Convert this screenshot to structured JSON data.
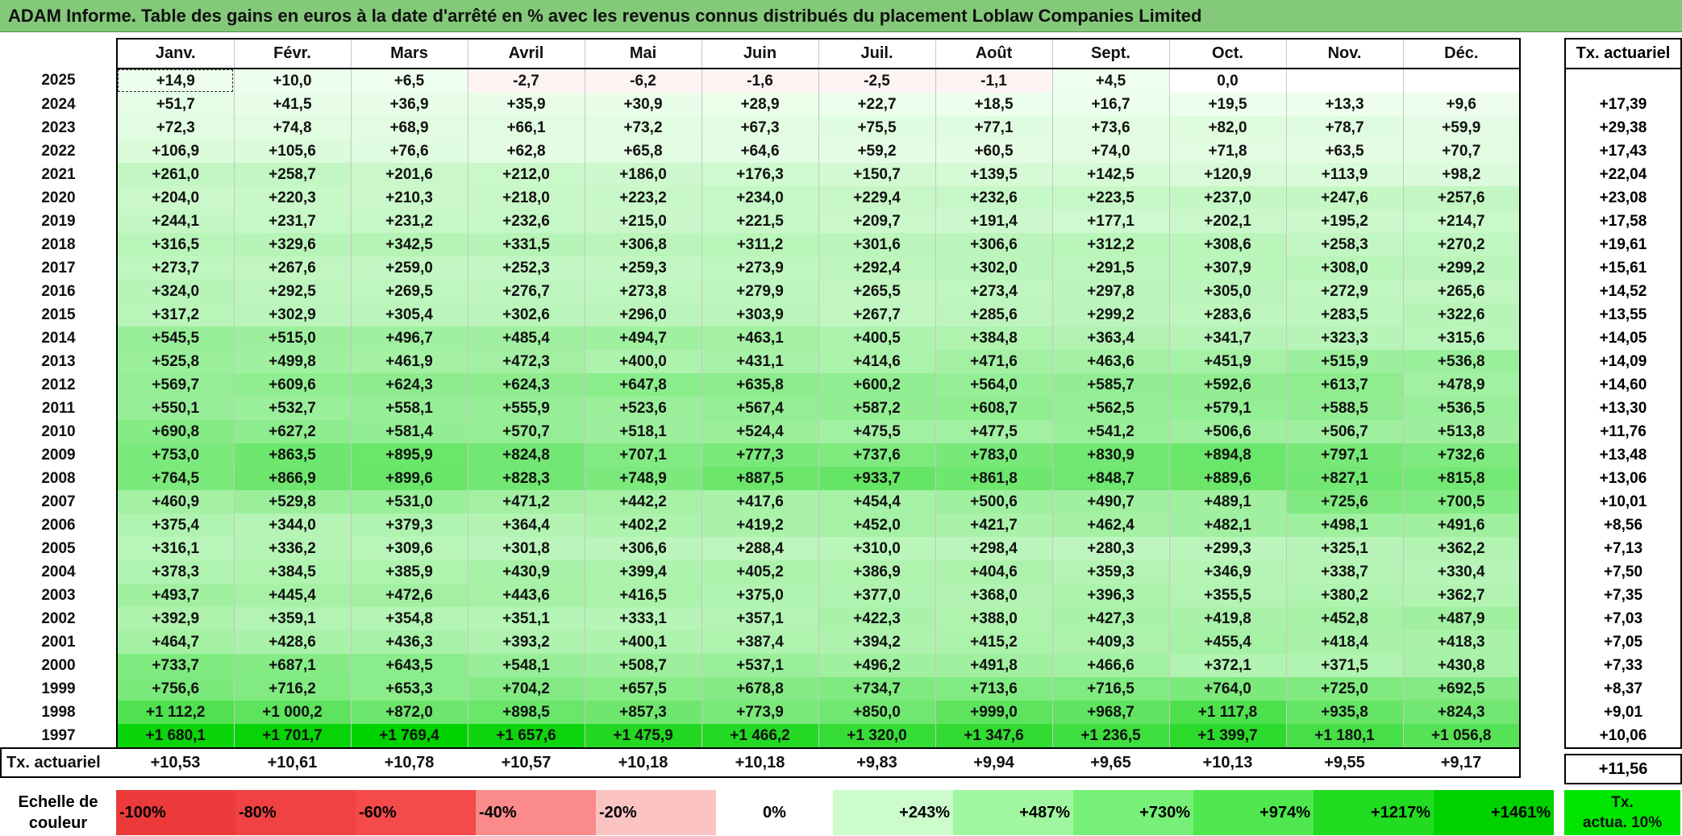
{
  "title": "ADAM Informe. Table des gains en euros à la date d'arrêté en % avec les revenus connus distribués du placement Loblaw Companies Limited",
  "months": [
    "Janv.",
    "Févr.",
    "Mars",
    "Avril",
    "Mai",
    "Juin",
    "Juil.",
    "Août",
    "Sept.",
    "Oct.",
    "Nov.",
    "Déc."
  ],
  "side_header": "Tx. actuariel",
  "rows": [
    {
      "year": "2025",
      "values": [
        "+14,9",
        "+10,0",
        "+6,5",
        "-2,7",
        "-6,2",
        "-1,6",
        "-2,5",
        "-1,1",
        "+4,5",
        "0,0",
        "",
        ""
      ],
      "tx": ""
    },
    {
      "year": "2024",
      "values": [
        "+51,7",
        "+41,5",
        "+36,9",
        "+35,9",
        "+30,9",
        "+28,9",
        "+22,7",
        "+18,5",
        "+16,7",
        "+19,5",
        "+13,3",
        "+9,6"
      ],
      "tx": "+17,39"
    },
    {
      "year": "2023",
      "values": [
        "+72,3",
        "+74,8",
        "+68,9",
        "+66,1",
        "+73,2",
        "+67,3",
        "+75,5",
        "+77,1",
        "+73,6",
        "+82,0",
        "+78,7",
        "+59,9"
      ],
      "tx": "+29,38"
    },
    {
      "year": "2022",
      "values": [
        "+106,9",
        "+105,6",
        "+76,6",
        "+62,8",
        "+65,8",
        "+64,6",
        "+59,2",
        "+60,5",
        "+74,0",
        "+71,8",
        "+63,5",
        "+70,7"
      ],
      "tx": "+17,43"
    },
    {
      "year": "2021",
      "values": [
        "+261,0",
        "+258,7",
        "+201,6",
        "+212,0",
        "+186,0",
        "+176,3",
        "+150,7",
        "+139,5",
        "+142,5",
        "+120,9",
        "+113,9",
        "+98,2"
      ],
      "tx": "+22,04"
    },
    {
      "year": "2020",
      "values": [
        "+204,0",
        "+220,3",
        "+210,3",
        "+218,0",
        "+223,2",
        "+234,0",
        "+229,4",
        "+232,6",
        "+223,5",
        "+237,0",
        "+247,6",
        "+257,6"
      ],
      "tx": "+23,08"
    },
    {
      "year": "2019",
      "values": [
        "+244,1",
        "+231,7",
        "+231,2",
        "+232,6",
        "+215,0",
        "+221,5",
        "+209,7",
        "+191,4",
        "+177,1",
        "+202,1",
        "+195,2",
        "+214,7"
      ],
      "tx": "+17,58"
    },
    {
      "year": "2018",
      "values": [
        "+316,5",
        "+329,6",
        "+342,5",
        "+331,5",
        "+306,8",
        "+311,2",
        "+301,6",
        "+306,6",
        "+312,2",
        "+308,6",
        "+258,3",
        "+270,2"
      ],
      "tx": "+19,61"
    },
    {
      "year": "2017",
      "values": [
        "+273,7",
        "+267,6",
        "+259,0",
        "+252,3",
        "+259,3",
        "+273,9",
        "+292,4",
        "+302,0",
        "+291,5",
        "+307,9",
        "+308,0",
        "+299,2"
      ],
      "tx": "+15,61"
    },
    {
      "year": "2016",
      "values": [
        "+324,0",
        "+292,5",
        "+269,5",
        "+276,7",
        "+273,8",
        "+279,9",
        "+265,5",
        "+273,4",
        "+297,8",
        "+305,0",
        "+272,9",
        "+265,6"
      ],
      "tx": "+14,52"
    },
    {
      "year": "2015",
      "values": [
        "+317,2",
        "+302,9",
        "+305,4",
        "+302,6",
        "+296,0",
        "+303,9",
        "+267,7",
        "+285,6",
        "+299,2",
        "+283,6",
        "+283,5",
        "+322,6"
      ],
      "tx": "+13,55"
    },
    {
      "year": "2014",
      "values": [
        "+545,5",
        "+515,0",
        "+496,7",
        "+485,4",
        "+494,7",
        "+463,1",
        "+400,5",
        "+384,8",
        "+363,4",
        "+341,7",
        "+323,3",
        "+315,6"
      ],
      "tx": "+14,05"
    },
    {
      "year": "2013",
      "values": [
        "+525,8",
        "+499,8",
        "+461,9",
        "+472,3",
        "+400,0",
        "+431,1",
        "+414,6",
        "+471,6",
        "+463,6",
        "+451,9",
        "+515,9",
        "+536,8"
      ],
      "tx": "+14,09"
    },
    {
      "year": "2012",
      "values": [
        "+569,7",
        "+609,6",
        "+624,3",
        "+624,3",
        "+647,8",
        "+635,8",
        "+600,2",
        "+564,0",
        "+585,7",
        "+592,6",
        "+613,7",
        "+478,9"
      ],
      "tx": "+14,60"
    },
    {
      "year": "2011",
      "values": [
        "+550,1",
        "+532,7",
        "+558,1",
        "+555,9",
        "+523,6",
        "+567,4",
        "+587,2",
        "+608,7",
        "+562,5",
        "+579,1",
        "+588,5",
        "+536,5"
      ],
      "tx": "+13,30"
    },
    {
      "year": "2010",
      "values": [
        "+690,8",
        "+627,2",
        "+581,4",
        "+570,7",
        "+518,1",
        "+524,4",
        "+475,5",
        "+477,5",
        "+541,2",
        "+506,6",
        "+506,7",
        "+513,8"
      ],
      "tx": "+11,76"
    },
    {
      "year": "2009",
      "values": [
        "+753,0",
        "+863,5",
        "+895,9",
        "+824,8",
        "+707,1",
        "+777,3",
        "+737,6",
        "+783,0",
        "+830,9",
        "+894,8",
        "+797,1",
        "+732,6"
      ],
      "tx": "+13,48"
    },
    {
      "year": "2008",
      "values": [
        "+764,5",
        "+866,9",
        "+899,6",
        "+828,3",
        "+748,9",
        "+887,5",
        "+933,7",
        "+861,8",
        "+848,7",
        "+889,6",
        "+827,1",
        "+815,8"
      ],
      "tx": "+13,06"
    },
    {
      "year": "2007",
      "values": [
        "+460,9",
        "+529,8",
        "+531,0",
        "+471,2",
        "+442,2",
        "+417,6",
        "+454,4",
        "+500,6",
        "+490,7",
        "+489,1",
        "+725,6",
        "+700,5"
      ],
      "tx": "+10,01"
    },
    {
      "year": "2006",
      "values": [
        "+375,4",
        "+344,0",
        "+379,3",
        "+364,4",
        "+402,2",
        "+419,2",
        "+452,0",
        "+421,7",
        "+462,4",
        "+482,1",
        "+498,1",
        "+491,6"
      ],
      "tx": "+8,56"
    },
    {
      "year": "2005",
      "values": [
        "+316,1",
        "+336,2",
        "+309,6",
        "+301,8",
        "+306,6",
        "+288,4",
        "+310,0",
        "+298,4",
        "+280,3",
        "+299,3",
        "+325,1",
        "+362,2"
      ],
      "tx": "+7,13"
    },
    {
      "year": "2004",
      "values": [
        "+378,3",
        "+384,5",
        "+385,9",
        "+430,9",
        "+399,4",
        "+405,2",
        "+386,9",
        "+404,6",
        "+359,3",
        "+346,9",
        "+338,7",
        "+330,4"
      ],
      "tx": "+7,50"
    },
    {
      "year": "2003",
      "values": [
        "+493,7",
        "+445,4",
        "+472,6",
        "+443,6",
        "+416,5",
        "+375,0",
        "+377,0",
        "+368,0",
        "+396,3",
        "+355,5",
        "+380,2",
        "+362,7"
      ],
      "tx": "+7,35"
    },
    {
      "year": "2002",
      "values": [
        "+392,9",
        "+359,1",
        "+354,8",
        "+351,1",
        "+333,1",
        "+357,1",
        "+422,3",
        "+388,0",
        "+427,3",
        "+419,8",
        "+452,8",
        "+487,9"
      ],
      "tx": "+7,03"
    },
    {
      "year": "2001",
      "values": [
        "+464,7",
        "+428,6",
        "+436,3",
        "+393,2",
        "+400,1",
        "+387,4",
        "+394,2",
        "+415,2",
        "+409,3",
        "+455,4",
        "+418,4",
        "+418,3"
      ],
      "tx": "+7,05"
    },
    {
      "year": "2000",
      "values": [
        "+733,7",
        "+687,1",
        "+643,5",
        "+548,1",
        "+508,7",
        "+537,1",
        "+496,2",
        "+491,8",
        "+466,6",
        "+372,1",
        "+371,5",
        "+430,8"
      ],
      "tx": "+7,33"
    },
    {
      "year": "1999",
      "values": [
        "+756,6",
        "+716,2",
        "+653,3",
        "+704,2",
        "+657,5",
        "+678,8",
        "+734,7",
        "+713,6",
        "+716,5",
        "+764,0",
        "+725,0",
        "+692,5"
      ],
      "tx": "+8,37"
    },
    {
      "year": "1998",
      "values": [
        "+1 112,2",
        "+1 000,2",
        "+872,0",
        "+898,5",
        "+857,3",
        "+773,9",
        "+850,0",
        "+999,0",
        "+968,7",
        "+1 117,8",
        "+935,8",
        "+824,3"
      ],
      "tx": "+9,01"
    },
    {
      "year": "1997",
      "values": [
        "+1 680,1",
        "+1 701,7",
        "+1 769,4",
        "+1 657,6",
        "+1 475,9",
        "+1 466,2",
        "+1 320,0",
        "+1 347,6",
        "+1 236,5",
        "+1 399,7",
        "+1 180,1",
        "+1 056,8"
      ],
      "tx": "+10,06"
    }
  ],
  "tx_row": {
    "label": "Tx. actuariel",
    "values": [
      "+10,53",
      "+10,61",
      "+10,78",
      "+10,57",
      "+10,18",
      "+10,18",
      "+9,83",
      "+9,94",
      "+9,65",
      "+10,13",
      "+9,55",
      "+9,17"
    ],
    "overall": "+11,56"
  },
  "scale": {
    "label": "Echelle de couleur",
    "steps": [
      {
        "text": "-100%",
        "color": "#ec3a3a",
        "align": "left"
      },
      {
        "text": "-80%",
        "color": "#f04242",
        "align": "left"
      },
      {
        "text": "-60%",
        "color": "#f44a4a",
        "align": "left"
      },
      {
        "text": "-40%",
        "color": "#fb8a8a",
        "align": "left"
      },
      {
        "text": "-20%",
        "color": "#fcc3c3",
        "align": "left"
      },
      {
        "text": "0%",
        "color": "#ffffff",
        "align": "center"
      },
      {
        "text": "+243%",
        "color": "#ccfccc",
        "align": "right"
      },
      {
        "text": "+487%",
        "color": "#a0f7a0",
        "align": "right"
      },
      {
        "text": "+730%",
        "color": "#77f077",
        "align": "right"
      },
      {
        "text": "+974%",
        "color": "#4ee84e",
        "align": "right"
      },
      {
        "text": "+1217%",
        "color": "#22dc22",
        "align": "right"
      },
      {
        "text": "+1461%",
        "color": "#00d200",
        "align": "right"
      }
    ],
    "legend_line1": "Tx.",
    "legend_line2": "actua. 10%",
    "legend_color": "#00e600"
  }
}
